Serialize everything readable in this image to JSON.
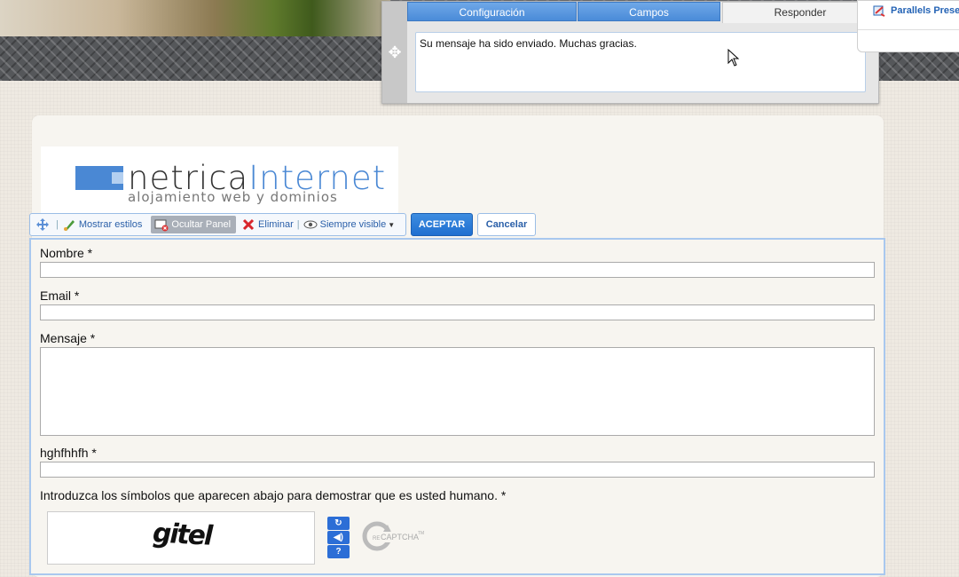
{
  "responder_panel": {
    "tabs": [
      {
        "label": "Configuración"
      },
      {
        "label": "Campos"
      },
      {
        "label": "Responder"
      }
    ],
    "message": "Su mensaje ha sido enviado. Muchas gracias."
  },
  "parallels": {
    "label": "Parallels Prese"
  },
  "logo": {
    "name_part1": "netrica",
    "name_part2": "Internet",
    "tagline": "alojamiento web y dominios"
  },
  "toolbar": {
    "mostrar_estilos": "Mostrar estilos",
    "ocultar_panel": "Ocultar Panel",
    "eliminar": "Eliminar",
    "siempre_visible": "Siempre visible",
    "aceptar": "ACEPTAR",
    "cancelar": "Cancelar"
  },
  "form": {
    "nombre_label": "Nombre *",
    "email_label": "Email *",
    "mensaje_label": "Mensaje *",
    "custom_label": "hghfhhfh *",
    "captcha_label": "Introduzca los símbolos que aparecen abajo para demostrar que es usted humano. *",
    "captcha_text": "gitel"
  },
  "colors": {
    "accent": "#4a88d4",
    "button_blue": "#1f6fd0",
    "link": "#2a5fa8"
  }
}
